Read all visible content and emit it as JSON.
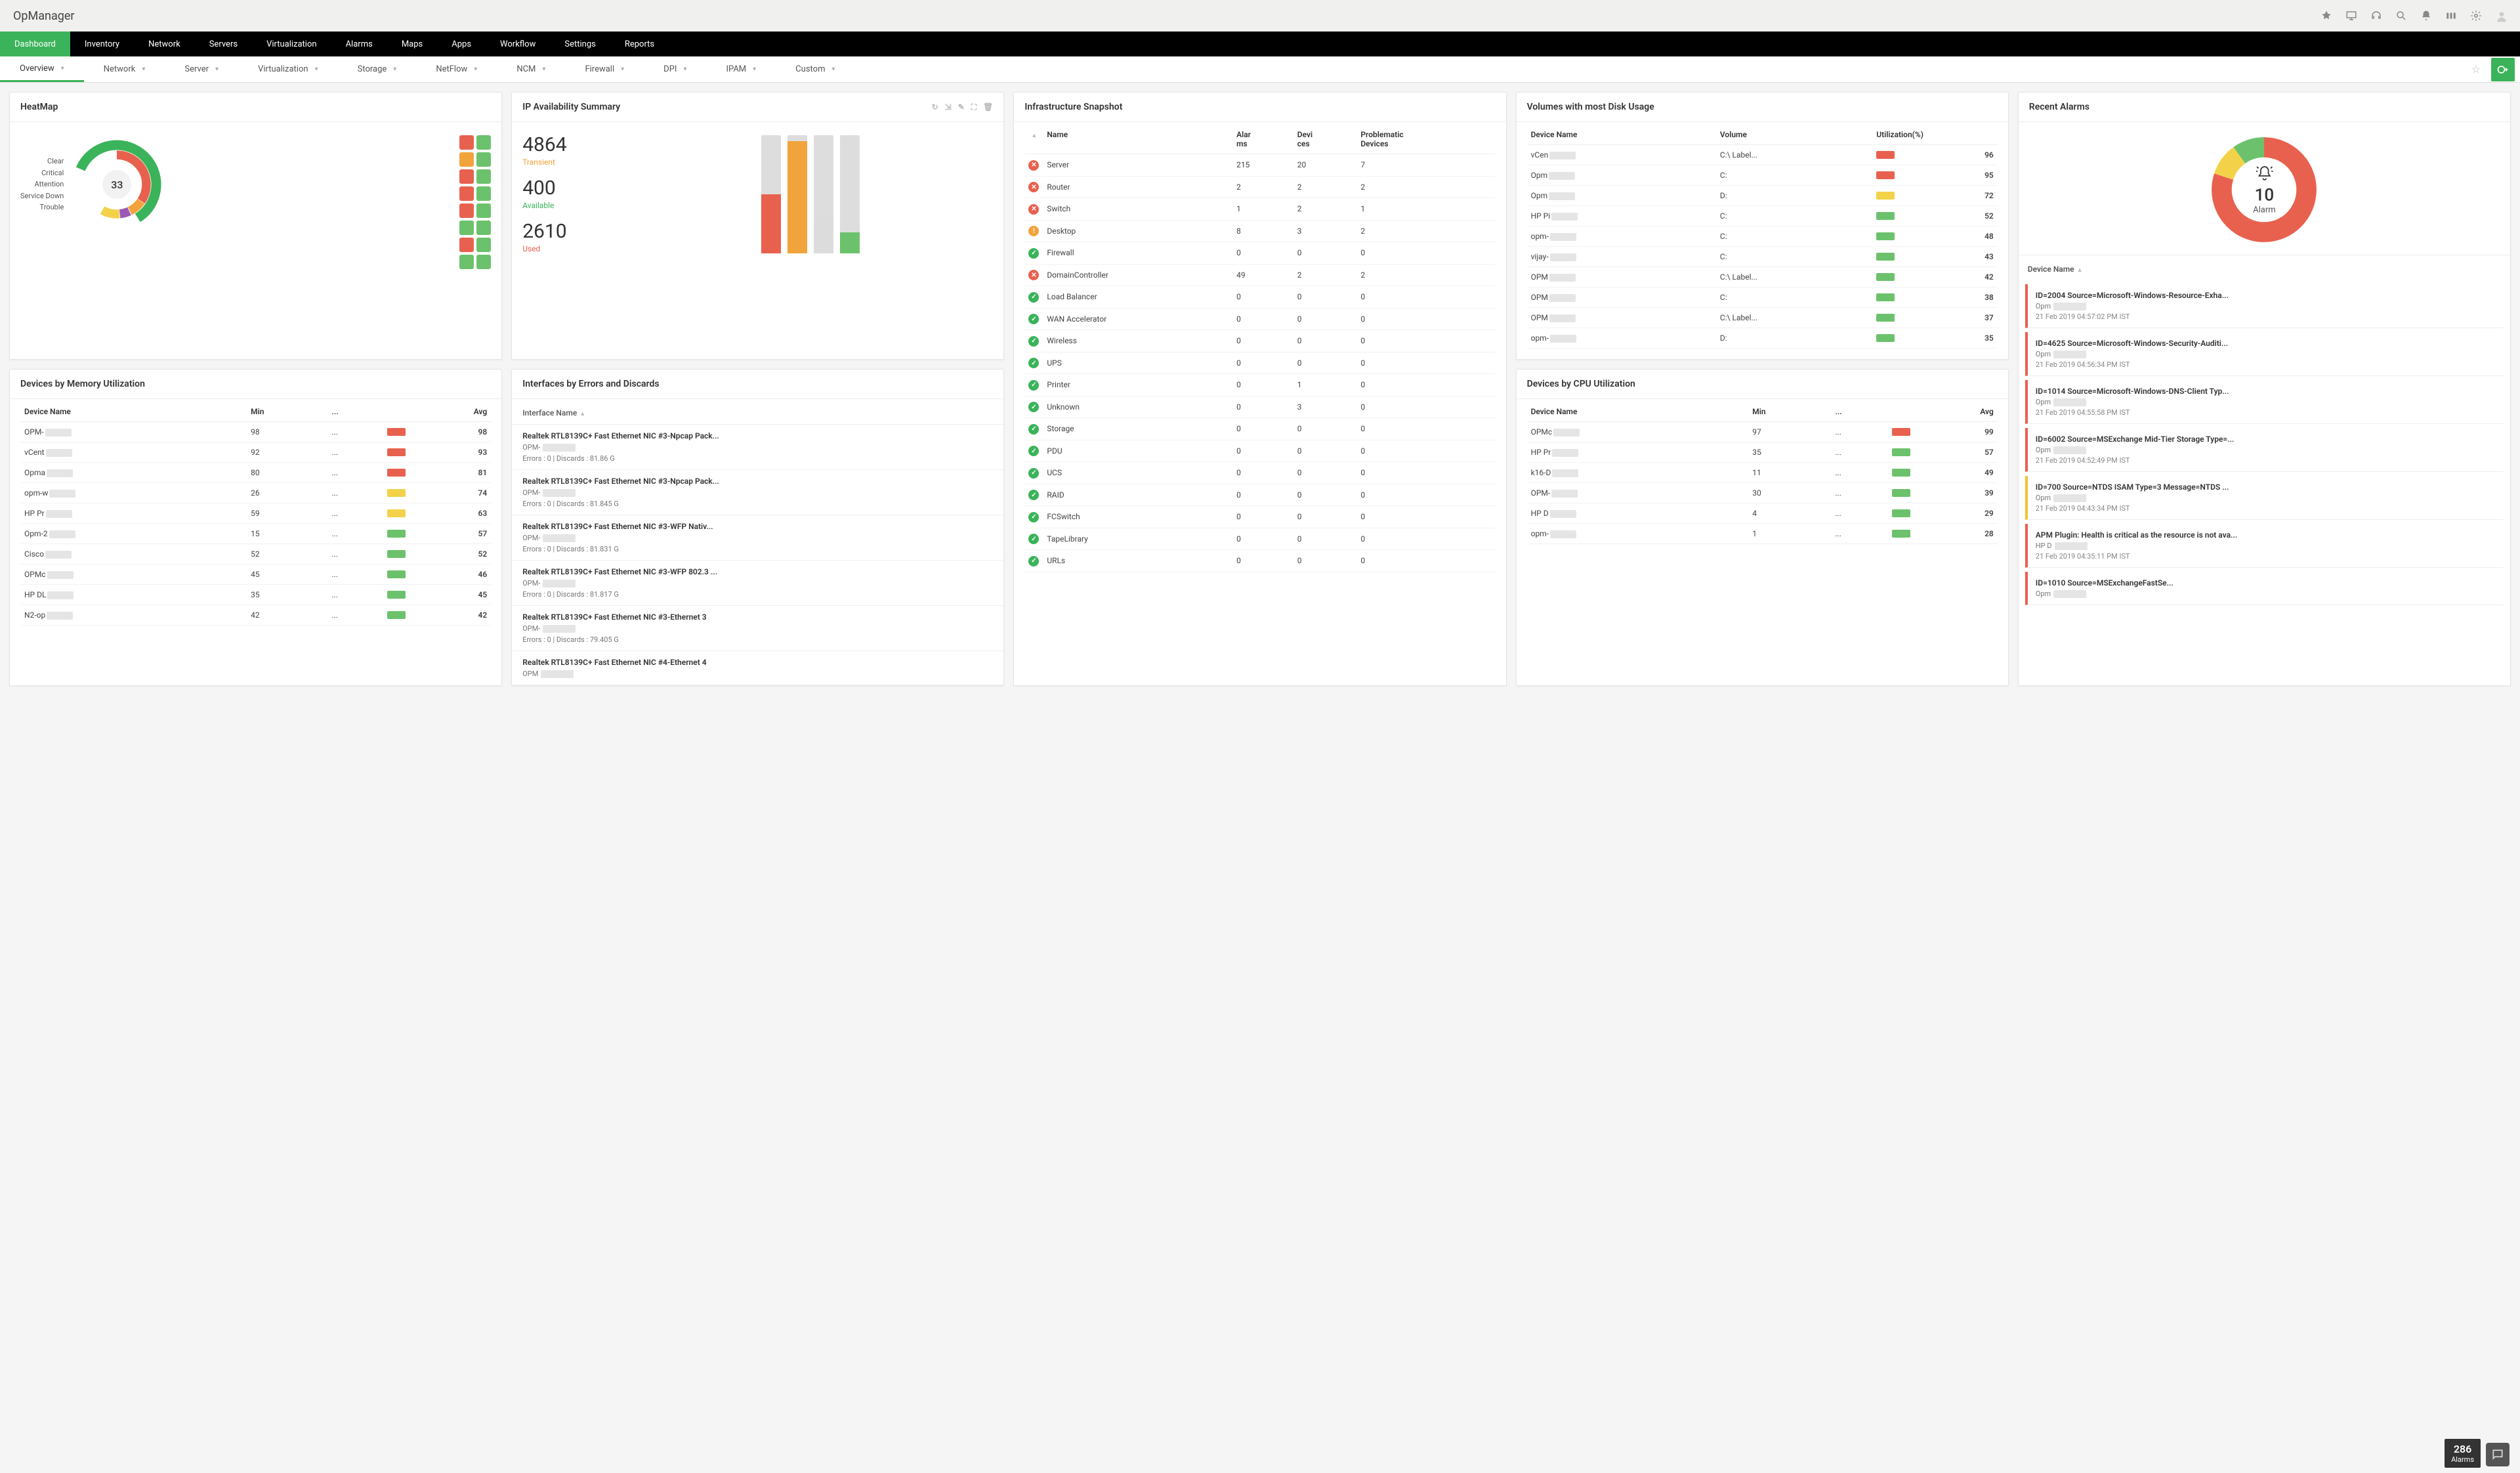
{
  "app": {
    "name": "OpManager"
  },
  "topnav": [
    "Dashboard",
    "Inventory",
    "Network",
    "Servers",
    "Virtualization",
    "Alarms",
    "Maps",
    "Apps",
    "Workflow",
    "Settings",
    "Reports"
  ],
  "subnav": [
    "Overview",
    "Network",
    "Server",
    "Virtualization",
    "Storage",
    "NetFlow",
    "NCM",
    "Firewall",
    "DPI",
    "IPAM",
    "Custom"
  ],
  "colors": {
    "green": "#3bb35a",
    "lightgreen": "#6cc26c",
    "red": "#e8614e",
    "orange": "#f1a33c",
    "yellow": "#f3d24a",
    "purple": "#9b59b6",
    "grey": "#dcdcdc",
    "darkorange": "#ea8a3a"
  },
  "heatmap": {
    "title": "HeatMap",
    "legend": [
      "Clear",
      "Critical",
      "Attention",
      "Service Down",
      "Trouble"
    ],
    "center": "33",
    "tile_colors": [
      "#e8614e",
      "#6cc26c",
      "#f1a33c",
      "#6cc26c",
      "#e8614e",
      "#6cc26c",
      "#e8614e",
      "#6cc26c",
      "#e8614e",
      "#6cc26c",
      "#6cc26c",
      "#6cc26c",
      "#e8614e",
      "#6cc26c",
      "#6cc26c",
      "#6cc26c"
    ]
  },
  "ip": {
    "title": "IP Availability Summary",
    "stats": [
      {
        "value": "4864",
        "label": "Transient",
        "color": "#f1a33c"
      },
      {
        "value": "400",
        "label": "Available",
        "color": "#3bb35a"
      },
      {
        "value": "2610",
        "label": "Used",
        "color": "#e8614e"
      }
    ],
    "bars": [
      {
        "total": 100,
        "segs": [
          {
            "h": 50,
            "c": "#e8614e"
          }
        ]
      },
      {
        "total": 100,
        "segs": [
          {
            "h": 95,
            "c": "#f1a33c"
          }
        ]
      },
      {
        "total": 100,
        "segs": [
          {
            "h": 30,
            "c": "#dcdcdc"
          }
        ]
      },
      {
        "total": 100,
        "segs": [
          {
            "h": 18,
            "c": "#6cc26c"
          }
        ]
      }
    ]
  },
  "mem": {
    "title": "Devices by Memory Utilization",
    "cols": [
      "Device Name",
      "Min",
      "...",
      "Avg"
    ],
    "rows": [
      {
        "name": "OPM-",
        "min": "98",
        "avg": "98",
        "color": "#e8614e"
      },
      {
        "name": "vCent",
        "min": "92",
        "avg": "93",
        "color": "#e8614e"
      },
      {
        "name": "Opma",
        "min": "80",
        "avg": "81",
        "color": "#e8614e"
      },
      {
        "name": "opm-w",
        "min": "26",
        "avg": "74",
        "color": "#f3d24a"
      },
      {
        "name": "HP Pr",
        "min": "59",
        "avg": "63",
        "color": "#f3d24a"
      },
      {
        "name": "Opm-2",
        "min": "15",
        "avg": "57",
        "color": "#6cc26c"
      },
      {
        "name": "Cisco",
        "min": "52",
        "avg": "52",
        "color": "#6cc26c"
      },
      {
        "name": "OPMc",
        "min": "45",
        "avg": "46",
        "color": "#6cc26c"
      },
      {
        "name": "HP DL",
        "min": "35",
        "avg": "45",
        "color": "#6cc26c"
      },
      {
        "name": "N2-op",
        "min": "42",
        "avg": "42",
        "color": "#6cc26c"
      }
    ]
  },
  "interfaces": {
    "title": "Interfaces by Errors and Discards",
    "header": "Interface Name",
    "rows": [
      {
        "name": "Realtek RTL8139C+ Fast Ethernet NIC #3-Npcap Pack...",
        "host": "OPM-",
        "stats": "Errors : 0 | Discards : 81.86 G"
      },
      {
        "name": "Realtek RTL8139C+ Fast Ethernet NIC #3-Npcap Pack...",
        "host": "OPM-",
        "stats": "Errors : 0 | Discards : 81.845 G"
      },
      {
        "name": "Realtek RTL8139C+ Fast Ethernet NIC #3-WFP Nativ...",
        "host": "OPM-",
        "stats": "Errors : 0 | Discards : 81.831 G"
      },
      {
        "name": "Realtek RTL8139C+ Fast Ethernet NIC #3-WFP 802.3 ...",
        "host": "OPM-",
        "stats": "Errors : 0 | Discards : 81.817 G"
      },
      {
        "name": "Realtek RTL8139C+ Fast Ethernet NIC #3-Ethernet 3",
        "host": "OPM-",
        "stats": "Errors : 0 | Discards : 79.405 G"
      },
      {
        "name": "Realtek RTL8139C+ Fast Ethernet NIC #4-Ethernet 4",
        "host": "OPM",
        "stats": ""
      }
    ]
  },
  "infra": {
    "title": "Infrastructure Snapshot",
    "cols": [
      "",
      "Name",
      "Alarms",
      "Devices",
      "Problematic Devices"
    ],
    "rows": [
      {
        "st": "err",
        "name": "Server",
        "a": "215",
        "d": "20",
        "p": "7"
      },
      {
        "st": "err",
        "name": "Router",
        "a": "2",
        "d": "2",
        "p": "2"
      },
      {
        "st": "err",
        "name": "Switch",
        "a": "1",
        "d": "2",
        "p": "1"
      },
      {
        "st": "warn",
        "name": "Desktop",
        "a": "8",
        "d": "3",
        "p": "2"
      },
      {
        "st": "ok",
        "name": "Firewall",
        "a": "0",
        "d": "0",
        "p": "0"
      },
      {
        "st": "err",
        "name": "DomainController",
        "a": "49",
        "d": "2",
        "p": "2"
      },
      {
        "st": "ok",
        "name": "Load Balancer",
        "a": "0",
        "d": "0",
        "p": "0"
      },
      {
        "st": "ok",
        "name": "WAN Accelerator",
        "a": "0",
        "d": "0",
        "p": "0"
      },
      {
        "st": "ok",
        "name": "Wireless",
        "a": "0",
        "d": "0",
        "p": "0"
      },
      {
        "st": "ok",
        "name": "UPS",
        "a": "0",
        "d": "0",
        "p": "0"
      },
      {
        "st": "ok",
        "name": "Printer",
        "a": "0",
        "d": "1",
        "p": "0"
      },
      {
        "st": "ok",
        "name": "Unknown",
        "a": "0",
        "d": "3",
        "p": "0"
      },
      {
        "st": "ok",
        "name": "Storage",
        "a": "0",
        "d": "0",
        "p": "0"
      },
      {
        "st": "ok",
        "name": "PDU",
        "a": "0",
        "d": "0",
        "p": "0"
      },
      {
        "st": "ok",
        "name": "UCS",
        "a": "0",
        "d": "0",
        "p": "0"
      },
      {
        "st": "ok",
        "name": "RAID",
        "a": "0",
        "d": "0",
        "p": "0"
      },
      {
        "st": "ok",
        "name": "FCSwitch",
        "a": "0",
        "d": "0",
        "p": "0"
      },
      {
        "st": "ok",
        "name": "TapeLibrary",
        "a": "0",
        "d": "0",
        "p": "0"
      },
      {
        "st": "ok",
        "name": "URLs",
        "a": "0",
        "d": "0",
        "p": "0"
      }
    ]
  },
  "disk": {
    "title": "Volumes with most Disk Usage",
    "cols": [
      "Device Name",
      "Volume",
      "Utilization(%)"
    ],
    "rows": [
      {
        "name": "vCen",
        "vol": "C:\\ Label...",
        "util": "96",
        "c": "#e8614e"
      },
      {
        "name": "Opm",
        "vol": "C:",
        "util": "95",
        "c": "#e8614e"
      },
      {
        "name": "Opm",
        "vol": "D:",
        "util": "72",
        "c": "#f3d24a"
      },
      {
        "name": "HP Pi",
        "vol": "C:",
        "util": "52",
        "c": "#6cc26c"
      },
      {
        "name": "opm-",
        "vol": "C:",
        "util": "48",
        "c": "#6cc26c"
      },
      {
        "name": "vijay-",
        "vol": "C:",
        "util": "43",
        "c": "#6cc26c"
      },
      {
        "name": "OPM",
        "vol": "C:\\ Label...",
        "util": "42",
        "c": "#6cc26c"
      },
      {
        "name": "OPM",
        "vol": "C:",
        "util": "38",
        "c": "#6cc26c"
      },
      {
        "name": "OPM",
        "vol": "C:\\ Label...",
        "util": "37",
        "c": "#6cc26c"
      },
      {
        "name": "opm-",
        "vol": "D:",
        "util": "35",
        "c": "#6cc26c"
      }
    ]
  },
  "cpu": {
    "title": "Devices by CPU Utilization",
    "cols": [
      "Device Name",
      "Min",
      "...",
      "Avg"
    ],
    "rows": [
      {
        "name": "OPMc",
        "min": "97",
        "avg": "99",
        "c": "#e8614e"
      },
      {
        "name": "HP Pr",
        "min": "35",
        "avg": "57",
        "c": "#6cc26c"
      },
      {
        "name": "k16-D",
        "min": "11",
        "avg": "49",
        "c": "#6cc26c"
      },
      {
        "name": "OPM-",
        "min": "30",
        "avg": "39",
        "c": "#6cc26c"
      },
      {
        "name": "HP D",
        "min": "4",
        "avg": "29",
        "c": "#6cc26c"
      },
      {
        "name": "opm-",
        "min": "1",
        "avg": "28",
        "c": "#6cc26c"
      }
    ]
  },
  "alarms": {
    "title": "Recent Alarms",
    "count": "10",
    "count_label": "Alarm",
    "dev_header": "Device Name",
    "rows": [
      {
        "sev": "r",
        "t": "ID=2004 Source=Microsoft-Windows-Resource-Exha...",
        "h": "Opm",
        "d": "21 Feb 2019 04:57:02 PM IST"
      },
      {
        "sev": "r",
        "t": "ID=4625 Source=Microsoft-Windows-Security-Auditi...",
        "h": "Opm",
        "d": "21 Feb 2019 04:56:34 PM IST"
      },
      {
        "sev": "r",
        "t": "ID=1014 Source=Microsoft-Windows-DNS-Client Typ...",
        "h": "Opm",
        "d": "21 Feb 2019 04:55:58 PM IST"
      },
      {
        "sev": "r",
        "t": "ID=6002 Source=MSExchange Mid-Tier Storage Type=...",
        "h": "Opm",
        "d": "21 Feb 2019 04:52:49 PM IST"
      },
      {
        "sev": "y",
        "t": "ID=700 Source=NTDS ISAM Type=3 Message=NTDS ...",
        "h": "Opm",
        "d": "21 Feb 2019 04:43:34 PM IST"
      },
      {
        "sev": "r",
        "t": "APM Plugin: Health is critical as the resource is not ava...",
        "h": "HP D",
        "d": "21 Feb 2019 04:35:11 PM IST"
      },
      {
        "sev": "r",
        "t": "ID=1010 Source=MSExchangeFastSe...",
        "h": "Opm",
        "d": ""
      }
    ]
  },
  "footer": {
    "alarm_count": "286",
    "alarm_label": "Alarms"
  },
  "chart_data": [
    {
      "type": "donut-gauge",
      "widget": "HeatMap",
      "center_value": 33,
      "legend": [
        "Clear",
        "Critical",
        "Attention",
        "Service Down",
        "Trouble"
      ],
      "segments": [
        {
          "label": "Clear",
          "color": "#3bb35a",
          "fraction": 0.42
        },
        {
          "label": "Critical",
          "color": "#e8614e",
          "fraction": 0.34
        },
        {
          "label": "Attention",
          "color": "#f1a33c",
          "fraction": 0.08
        },
        {
          "label": "Service Down",
          "color": "#9b59b6",
          "fraction": 0.05
        },
        {
          "label": "Trouble",
          "color": "#f3d24a",
          "fraction": 0.11
        }
      ]
    },
    {
      "type": "bar",
      "widget": "IP Availability Summary",
      "title": "",
      "ylim": [
        0,
        7874
      ],
      "series": [
        {
          "name": "Used",
          "color": "#e8614e",
          "values": [
            2610,
            0,
            0,
            0
          ]
        },
        {
          "name": "Transient",
          "color": "#f1a33c",
          "values": [
            0,
            4864,
            0,
            0
          ]
        },
        {
          "name": "Available",
          "color": "#6cc26c",
          "values": [
            0,
            0,
            0,
            400
          ]
        }
      ],
      "categories": [
        "",
        "",
        "",
        ""
      ]
    },
    {
      "type": "donut",
      "widget": "Recent Alarms",
      "center_value": 10,
      "center_label": "Alarm",
      "segments": [
        {
          "label": "Critical",
          "color": "#e8614e",
          "value": 8
        },
        {
          "label": "Trouble",
          "color": "#f3d24a",
          "value": 1
        },
        {
          "label": "Clear",
          "color": "#6cc26c",
          "value": 1
        }
      ]
    }
  ]
}
